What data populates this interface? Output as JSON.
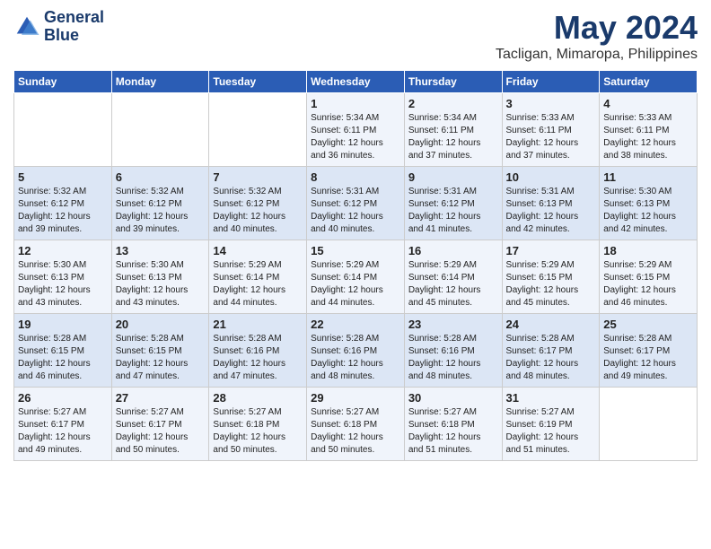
{
  "logo": {
    "line1": "General",
    "line2": "Blue"
  },
  "title": "May 2024",
  "subtitle": "Tacligan, Mimaropa, Philippines",
  "weekdays": [
    "Sunday",
    "Monday",
    "Tuesday",
    "Wednesday",
    "Thursday",
    "Friday",
    "Saturday"
  ],
  "weeks": [
    [
      {
        "day": "",
        "info": ""
      },
      {
        "day": "",
        "info": ""
      },
      {
        "day": "",
        "info": ""
      },
      {
        "day": "1",
        "info": "Sunrise: 5:34 AM\nSunset: 6:11 PM\nDaylight: 12 hours\nand 36 minutes."
      },
      {
        "day": "2",
        "info": "Sunrise: 5:34 AM\nSunset: 6:11 PM\nDaylight: 12 hours\nand 37 minutes."
      },
      {
        "day": "3",
        "info": "Sunrise: 5:33 AM\nSunset: 6:11 PM\nDaylight: 12 hours\nand 37 minutes."
      },
      {
        "day": "4",
        "info": "Sunrise: 5:33 AM\nSunset: 6:11 PM\nDaylight: 12 hours\nand 38 minutes."
      }
    ],
    [
      {
        "day": "5",
        "info": "Sunrise: 5:32 AM\nSunset: 6:12 PM\nDaylight: 12 hours\nand 39 minutes."
      },
      {
        "day": "6",
        "info": "Sunrise: 5:32 AM\nSunset: 6:12 PM\nDaylight: 12 hours\nand 39 minutes."
      },
      {
        "day": "7",
        "info": "Sunrise: 5:32 AM\nSunset: 6:12 PM\nDaylight: 12 hours\nand 40 minutes."
      },
      {
        "day": "8",
        "info": "Sunrise: 5:31 AM\nSunset: 6:12 PM\nDaylight: 12 hours\nand 40 minutes."
      },
      {
        "day": "9",
        "info": "Sunrise: 5:31 AM\nSunset: 6:12 PM\nDaylight: 12 hours\nand 41 minutes."
      },
      {
        "day": "10",
        "info": "Sunrise: 5:31 AM\nSunset: 6:13 PM\nDaylight: 12 hours\nand 42 minutes."
      },
      {
        "day": "11",
        "info": "Sunrise: 5:30 AM\nSunset: 6:13 PM\nDaylight: 12 hours\nand 42 minutes."
      }
    ],
    [
      {
        "day": "12",
        "info": "Sunrise: 5:30 AM\nSunset: 6:13 PM\nDaylight: 12 hours\nand 43 minutes."
      },
      {
        "day": "13",
        "info": "Sunrise: 5:30 AM\nSunset: 6:13 PM\nDaylight: 12 hours\nand 43 minutes."
      },
      {
        "day": "14",
        "info": "Sunrise: 5:29 AM\nSunset: 6:14 PM\nDaylight: 12 hours\nand 44 minutes."
      },
      {
        "day": "15",
        "info": "Sunrise: 5:29 AM\nSunset: 6:14 PM\nDaylight: 12 hours\nand 44 minutes."
      },
      {
        "day": "16",
        "info": "Sunrise: 5:29 AM\nSunset: 6:14 PM\nDaylight: 12 hours\nand 45 minutes."
      },
      {
        "day": "17",
        "info": "Sunrise: 5:29 AM\nSunset: 6:15 PM\nDaylight: 12 hours\nand 45 minutes."
      },
      {
        "day": "18",
        "info": "Sunrise: 5:29 AM\nSunset: 6:15 PM\nDaylight: 12 hours\nand 46 minutes."
      }
    ],
    [
      {
        "day": "19",
        "info": "Sunrise: 5:28 AM\nSunset: 6:15 PM\nDaylight: 12 hours\nand 46 minutes."
      },
      {
        "day": "20",
        "info": "Sunrise: 5:28 AM\nSunset: 6:15 PM\nDaylight: 12 hours\nand 47 minutes."
      },
      {
        "day": "21",
        "info": "Sunrise: 5:28 AM\nSunset: 6:16 PM\nDaylight: 12 hours\nand 47 minutes."
      },
      {
        "day": "22",
        "info": "Sunrise: 5:28 AM\nSunset: 6:16 PM\nDaylight: 12 hours\nand 48 minutes."
      },
      {
        "day": "23",
        "info": "Sunrise: 5:28 AM\nSunset: 6:16 PM\nDaylight: 12 hours\nand 48 minutes."
      },
      {
        "day": "24",
        "info": "Sunrise: 5:28 AM\nSunset: 6:17 PM\nDaylight: 12 hours\nand 48 minutes."
      },
      {
        "day": "25",
        "info": "Sunrise: 5:28 AM\nSunset: 6:17 PM\nDaylight: 12 hours\nand 49 minutes."
      }
    ],
    [
      {
        "day": "26",
        "info": "Sunrise: 5:27 AM\nSunset: 6:17 PM\nDaylight: 12 hours\nand 49 minutes."
      },
      {
        "day": "27",
        "info": "Sunrise: 5:27 AM\nSunset: 6:17 PM\nDaylight: 12 hours\nand 50 minutes."
      },
      {
        "day": "28",
        "info": "Sunrise: 5:27 AM\nSunset: 6:18 PM\nDaylight: 12 hours\nand 50 minutes."
      },
      {
        "day": "29",
        "info": "Sunrise: 5:27 AM\nSunset: 6:18 PM\nDaylight: 12 hours\nand 50 minutes."
      },
      {
        "day": "30",
        "info": "Sunrise: 5:27 AM\nSunset: 6:18 PM\nDaylight: 12 hours\nand 51 minutes."
      },
      {
        "day": "31",
        "info": "Sunrise: 5:27 AM\nSunset: 6:19 PM\nDaylight: 12 hours\nand 51 minutes."
      },
      {
        "day": "",
        "info": ""
      }
    ]
  ]
}
